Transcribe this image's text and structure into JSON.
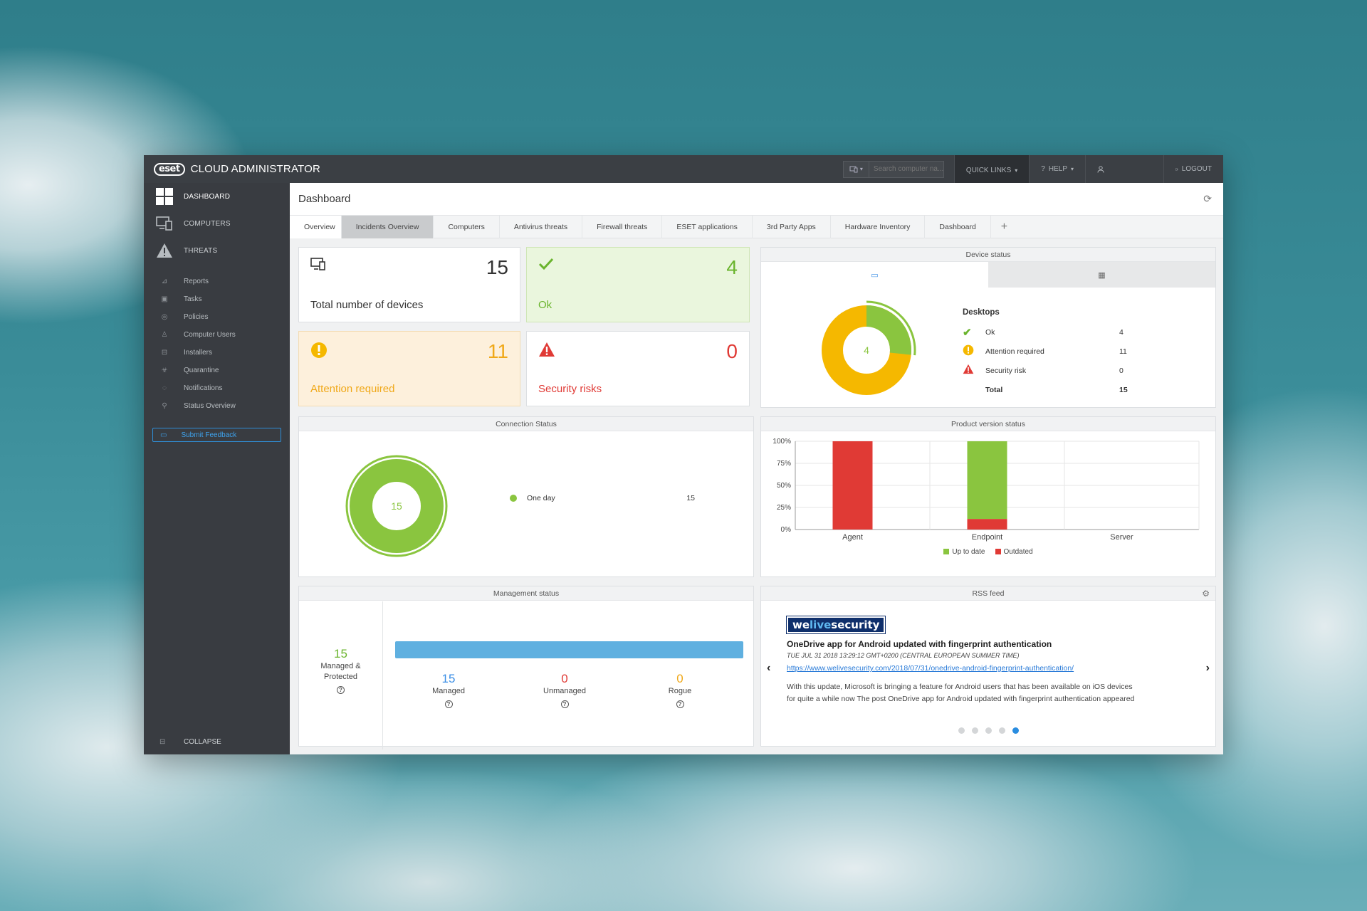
{
  "app": {
    "logo": "eset",
    "title": "CLOUD ADMINISTRATOR"
  },
  "topbar": {
    "search_placeholder": "Search computer na...",
    "quick_links": "QUICK LINKS",
    "help": "HELP",
    "logout": "LOGOUT"
  },
  "sidebar": {
    "main": [
      {
        "label": "DASHBOARD",
        "icon": "dashboard-grid-icon"
      },
      {
        "label": "COMPUTERS",
        "icon": "computers-icon"
      },
      {
        "label": "THREATS",
        "icon": "warning-triangle-icon"
      }
    ],
    "sub": [
      {
        "label": "Reports",
        "icon": "reports-icon"
      },
      {
        "label": "Tasks",
        "icon": "tasks-icon"
      },
      {
        "label": "Policies",
        "icon": "policies-icon"
      },
      {
        "label": "Computer Users",
        "icon": "user-icon"
      },
      {
        "label": "Installers",
        "icon": "installers-icon"
      },
      {
        "label": "Quarantine",
        "icon": "quarantine-icon"
      },
      {
        "label": "Notifications",
        "icon": "notifications-icon"
      },
      {
        "label": "Status Overview",
        "icon": "status-overview-icon"
      }
    ],
    "feedback": "Submit Feedback",
    "collapse": "COLLAPSE"
  },
  "page": {
    "title": "Dashboard"
  },
  "tabs": [
    "Overview",
    "Incidents Overview",
    "Computers",
    "Antivirus threats",
    "Firewall threats",
    "ESET applications",
    "3rd Party Apps",
    "Hardware Inventory",
    "Dashboard"
  ],
  "active_tab": "Incidents Overview",
  "stats": {
    "total": {
      "value": "15",
      "label": "Total number of devices",
      "color": "#333333"
    },
    "ok": {
      "value": "4",
      "label": "Ok",
      "color": "#6ab42d"
    },
    "attention": {
      "value": "11",
      "label": "Attention required",
      "color": "#f0a818"
    },
    "risks": {
      "value": "0",
      "label": "Security risks",
      "color": "#e03a35"
    }
  },
  "device_status": {
    "title": "Device status",
    "center": "4",
    "heading": "Desktops",
    "rows": [
      {
        "label": "Ok",
        "value": "4"
      },
      {
        "label": "Attention required",
        "value": "11"
      },
      {
        "label": "Security risk",
        "value": "0"
      }
    ],
    "total_label": "Total",
    "total_value": "15"
  },
  "connection_status": {
    "title": "Connection Status",
    "center": "15",
    "legend_label": "One day",
    "legend_value": "15"
  },
  "product_version": {
    "title": "Product version status",
    "legend_up": "Up to date",
    "legend_out": "Outdated"
  },
  "management": {
    "title": "Management status",
    "protected_value": "15",
    "protected_label_1": "Managed &",
    "protected_label_2": "Protected",
    "managed_value": "15",
    "managed_label": "Managed",
    "unmanaged_value": "0",
    "unmanaged_label": "Unmanaged",
    "rogue_value": "0",
    "rogue_label": "Rogue"
  },
  "rss": {
    "title": "RSS feed",
    "logo_a": "we",
    "logo_b": "live",
    "logo_c": "security",
    "headline": "OneDrive app for Android updated with fingerprint authentication",
    "date": "TUE JUL 31 2018 13:29:12 GMT+0200 (CENTRAL EUROPEAN SUMMER TIME)",
    "link": "https://www.welivesecurity.com/2018/07/31/onedrive-android-fingerprint-authentication/",
    "text_1": "With this update, Microsoft is bringing a feature for Android users that has been available on iOS devices",
    "text_2": "for quite a while now The post OneDrive app for Android updated with fingerprint authentication appeared",
    "active_slide": 5,
    "slides": 5
  },
  "chart_data": [
    {
      "type": "bar",
      "categories": [
        "Agent",
        "Endpoint",
        "Server"
      ],
      "series": [
        {
          "name": "Up to date",
          "values": [
            0,
            88,
            0
          ],
          "color": "#8ac53f"
        },
        {
          "name": "Outdated",
          "values": [
            100,
            12,
            0
          ],
          "color": "#e03a35"
        }
      ],
      "ylim": [
        0,
        100
      ],
      "yticks": [
        "0%",
        "25%",
        "50%",
        "75%",
        "100%"
      ],
      "stacked": true,
      "legend": "bottom"
    },
    {
      "type": "pie",
      "title": "Device status",
      "labels": [
        "Ok",
        "Attention required",
        "Security risk"
      ],
      "values": [
        4,
        11,
        0
      ],
      "colors": [
        "#8ac53f",
        "#f5b800",
        "#e03a35"
      ]
    },
    {
      "type": "pie",
      "title": "Connection Status",
      "labels": [
        "One day"
      ],
      "values": [
        15
      ],
      "colors": [
        "#8ac53f"
      ]
    }
  ]
}
